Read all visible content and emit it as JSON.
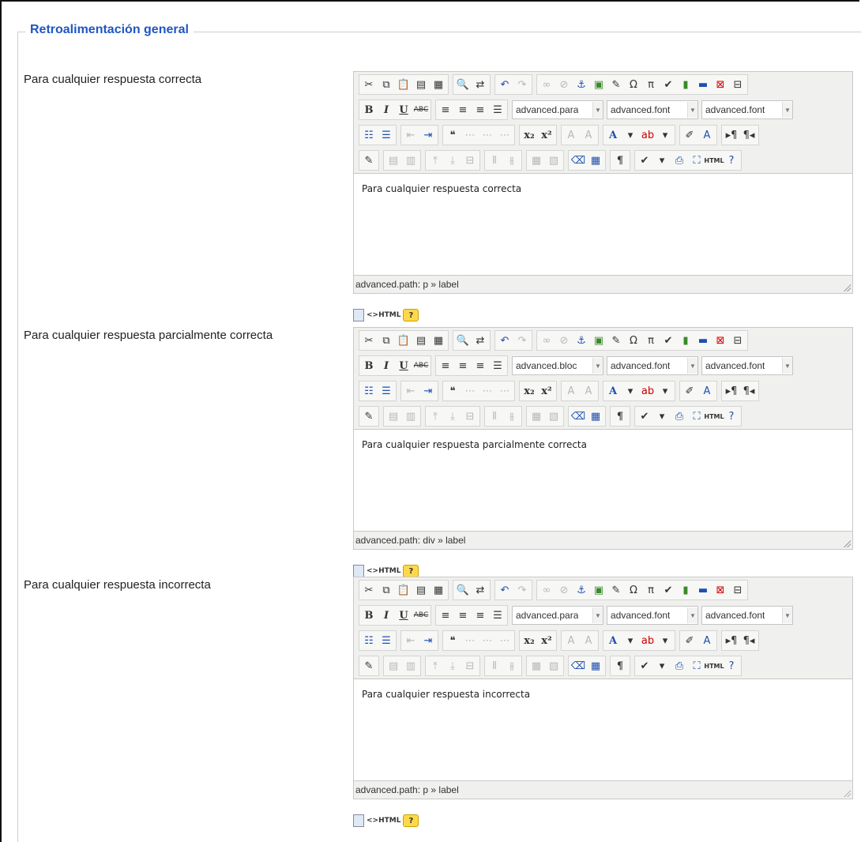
{
  "section": {
    "title": "Retroalimentación general"
  },
  "editors": [
    {
      "label": "Para cualquier respuesta correcta",
      "content": "Para cualquier respuesta correcta",
      "selects": [
        "advanced.para",
        "advanced.font",
        "advanced.font"
      ],
      "path": "advanced.path: p » label"
    },
    {
      "label": "Para cualquier respuesta parcialmente correcta",
      "content": "Para cualquier respuesta parcialmente correcta",
      "selects": [
        "advanced.bloc",
        "advanced.font",
        "advanced.font"
      ],
      "path": "advanced.path: div » label"
    },
    {
      "label": "Para cualquier respuesta incorrecta",
      "content": "Para cualquier respuesta incorrecta",
      "selects": [
        "advanced.para",
        "advanced.font",
        "advanced.font"
      ],
      "path": "advanced.path: p » label"
    }
  ],
  "toolbar": {
    "bold": "B",
    "italic": "I",
    "underline": "U",
    "strike": "ABC",
    "sub": "x₂",
    "sup": "x²",
    "omega": "Ω",
    "pi": "π",
    "pilcrow": "¶",
    "html": "HTML"
  },
  "below_bar": {
    "html_label": "<>HTML",
    "help_label": "?"
  }
}
